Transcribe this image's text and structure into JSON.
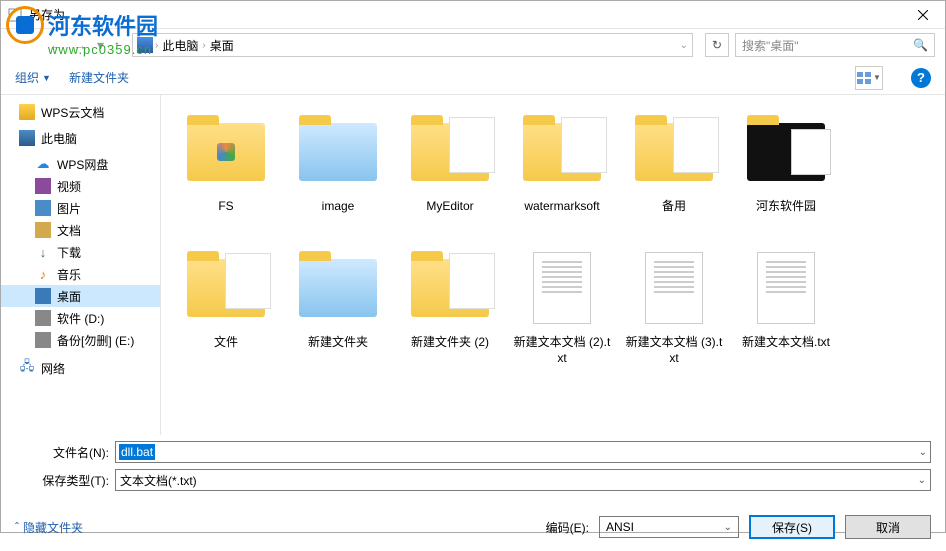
{
  "title": "另存为",
  "watermark": {
    "text": "河东软件园",
    "url": "www.pc0359.cn"
  },
  "breadcrumb": {
    "pc": "此电脑",
    "desktop": "桌面"
  },
  "search": {
    "placeholder": "搜索\"桌面\""
  },
  "toolbar": {
    "organize": "组织",
    "newfolder": "新建文件夹"
  },
  "sidebar": {
    "wps_cloud": "WPS云文档",
    "pc": "此电脑",
    "wps_disk": "WPS网盘",
    "video": "视频",
    "pictures": "图片",
    "documents": "文档",
    "downloads": "下载",
    "music": "音乐",
    "desktop": "桌面",
    "drive_d": "软件 (D:)",
    "drive_e": "备份[勿删] (E:)",
    "network": "网络"
  },
  "files": [
    {
      "name": "FS",
      "type": "folder-icon"
    },
    {
      "name": "image",
      "type": "folder-img"
    },
    {
      "name": "MyEditor",
      "type": "folder-doc"
    },
    {
      "name": "watermarksoft",
      "type": "folder-doc"
    },
    {
      "name": "备用",
      "type": "folder-doc"
    },
    {
      "name": "河东软件园",
      "type": "folder-dark"
    },
    {
      "name": "文件",
      "type": "folder-doc"
    },
    {
      "name": "新建文件夹",
      "type": "folder-img"
    },
    {
      "name": "新建文件夹 (2)",
      "type": "folder-doc"
    },
    {
      "name": "新建文本文档 (2).txt",
      "type": "txt"
    },
    {
      "name": "新建文本文档 (3).txt",
      "type": "txt"
    },
    {
      "name": "新建文本文档.txt",
      "type": "txt"
    }
  ],
  "form": {
    "filename_label": "文件名(N):",
    "filename_value": "dll.bat",
    "savetype_label": "保存类型(T):",
    "savetype_value": "文本文档(*.txt)"
  },
  "bottom": {
    "hide_folders": "隐藏文件夹",
    "encoding_label": "编码(E):",
    "encoding_value": "ANSI",
    "save": "保存(S)",
    "cancel": "取消"
  }
}
